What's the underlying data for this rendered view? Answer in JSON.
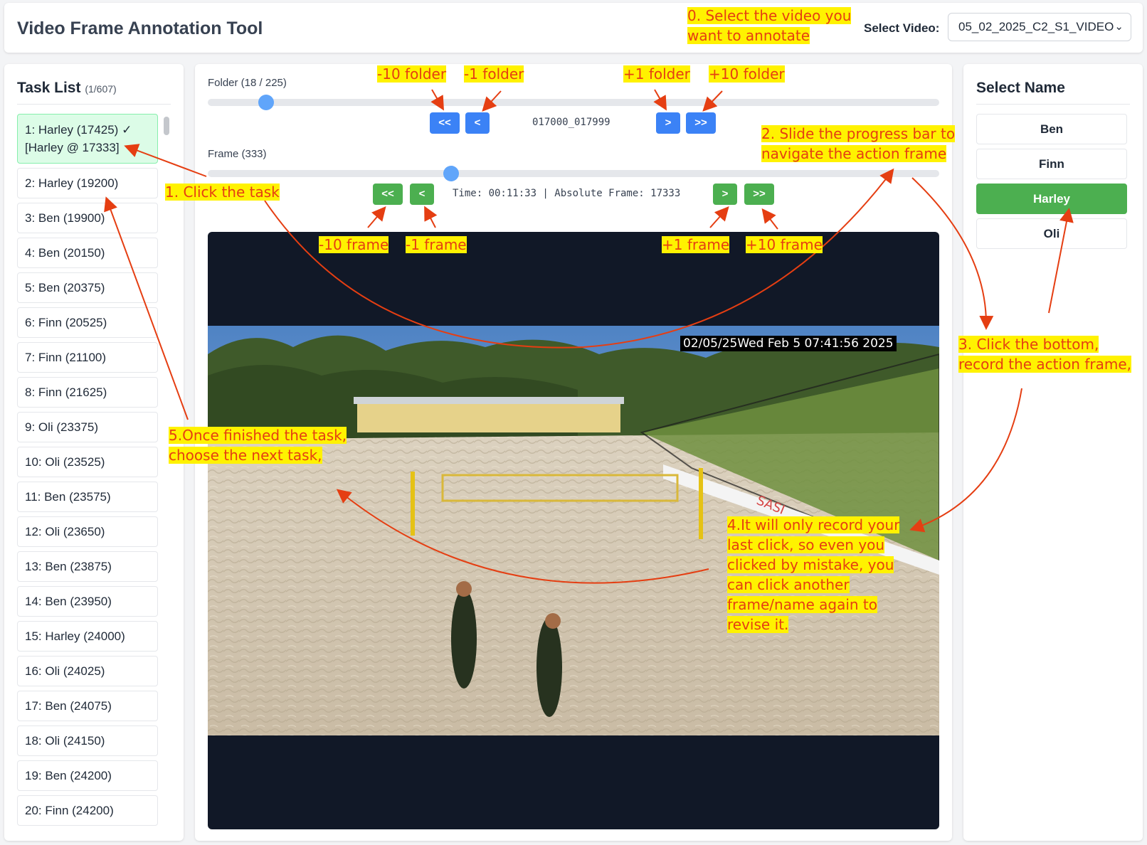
{
  "header": {
    "title": "Video Frame Annotation Tool",
    "select_label": "Select Video:",
    "selected_video": "05_02_2025_C2_S1_VIDEO"
  },
  "task_panel": {
    "title": "Task List",
    "count": "(1/607)",
    "tasks": [
      {
        "label": "1: Harley (17425) ✓ [Harley @ 17333]"
      },
      {
        "label": "2: Harley (19200)"
      },
      {
        "label": "3: Ben (19900)"
      },
      {
        "label": "4: Ben (20150)"
      },
      {
        "label": "5: Ben (20375)"
      },
      {
        "label": "6: Finn (20525)"
      },
      {
        "label": "7: Finn (21100)"
      },
      {
        "label": "8: Finn (21625)"
      },
      {
        "label": "9: Oli (23375)"
      },
      {
        "label": "10: Oli (23525)"
      },
      {
        "label": "11: Ben (23575)"
      },
      {
        "label": "12: Oli (23650)"
      },
      {
        "label": "13: Ben (23875)"
      },
      {
        "label": "14: Ben (23950)"
      },
      {
        "label": "15: Harley (24000)"
      },
      {
        "label": "16: Oli (24025)"
      },
      {
        "label": "17: Ben (24075)"
      },
      {
        "label": "18: Oli (24150)"
      },
      {
        "label": "19: Ben (24200)"
      },
      {
        "label": "20: Finn (24200)"
      }
    ]
  },
  "folder": {
    "label": "Folder (18 / 225)",
    "progress": 0.08,
    "name": "017000_017999",
    "btn_back10": "<<",
    "btn_back1": "<",
    "btn_fwd1": ">",
    "btn_fwd10": ">>"
  },
  "frame": {
    "label": "Frame (333)",
    "progress": 0.333,
    "info": "Time: 00:11:33 | Absolute Frame: 17333",
    "btn_back10": "<<",
    "btn_back1": "<",
    "btn_fwd1": ">",
    "btn_fwd10": ">>"
  },
  "video": {
    "timestamp": "02/05/25Wed Feb  5 07:41:56 2025",
    "banner": "SASI"
  },
  "name_panel": {
    "title": "Select Name",
    "names": [
      "Ben",
      "Finn",
      "Harley",
      "Oli"
    ],
    "selected": "Harley"
  },
  "annotations": {
    "step0": "0. Select the video you want to annotate",
    "minus10_folder": "-10 folder",
    "minus1_folder": "-1 folder",
    "plus1_folder": "+1 folder",
    "plus10_folder": "+10 folder",
    "step1": "1. Click the task",
    "step2": "2. Slide the progress bar to navigate the action frame",
    "minus10_frame": "-10 frame",
    "minus1_frame": "-1 frame",
    "plus1_frame": "+1 frame",
    "plus10_frame": "+10 frame",
    "step3": "3. Click the bottom, record the action frame,",
    "step4": "4.It will only record your last click, so even you clicked by mistake, you can click another frame/name again to revise it.",
    "step5": "5.Once finished the task, choose the next task,"
  },
  "colors": {
    "accent_green": "#4caf50",
    "accent_blue": "#3b82f6",
    "annotation_text": "#e53e12",
    "annotation_highlight": "#fff200"
  }
}
